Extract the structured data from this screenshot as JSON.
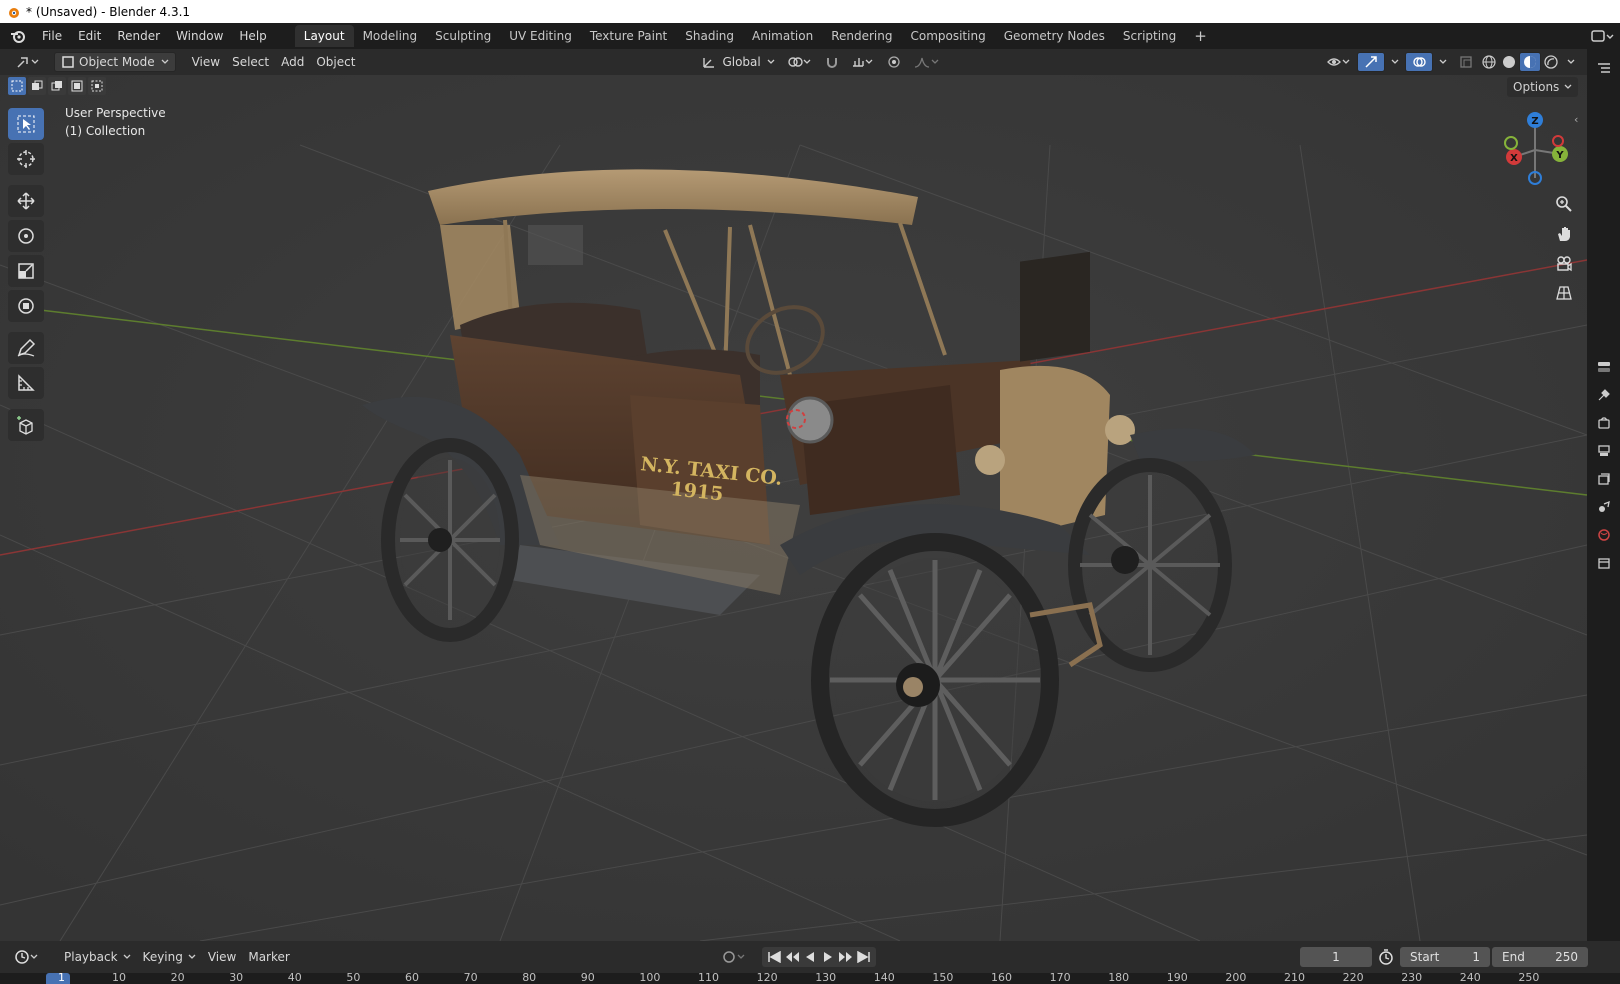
{
  "window": {
    "title": "* (Unsaved) - Blender 4.3.1"
  },
  "menu": [
    "File",
    "Edit",
    "Render",
    "Window",
    "Help"
  ],
  "workspaces": [
    "Layout",
    "Modeling",
    "Sculpting",
    "UV Editing",
    "Texture Paint",
    "Shading",
    "Animation",
    "Rendering",
    "Compositing",
    "Geometry Nodes",
    "Scripting"
  ],
  "active_workspace": "Layout",
  "viewport_header": {
    "mode": "Object Mode",
    "menus": [
      "View",
      "Select",
      "Add",
      "Object"
    ],
    "orientation": "Global",
    "options_label": "Options"
  },
  "viewport": {
    "perspective_label": "User Perspective",
    "collection_label": "(1) Collection",
    "vehicle_text_line1": "N.Y. TAXI CO.",
    "vehicle_text_line2": "1915",
    "gizmo": {
      "x": "X",
      "y": "Y",
      "z": "Z"
    }
  },
  "timeline": {
    "menus": [
      "Playback",
      "Keying",
      "View",
      "Marker"
    ],
    "current_frame": "1",
    "start_label": "Start",
    "start_value": "1",
    "end_label": "End",
    "end_value": "250",
    "ticks": [
      "1",
      "10",
      "20",
      "30",
      "40",
      "50",
      "60",
      "70",
      "80",
      "90",
      "100",
      "110",
      "120",
      "130",
      "140",
      "150",
      "160",
      "170",
      "180",
      "190",
      "200",
      "210",
      "220",
      "230",
      "240",
      "250"
    ]
  },
  "colors": {
    "accent": "#4772b3",
    "x_axis": "#d23a3a",
    "y_axis": "#86b33a",
    "z_axis": "#2f7ed8"
  }
}
